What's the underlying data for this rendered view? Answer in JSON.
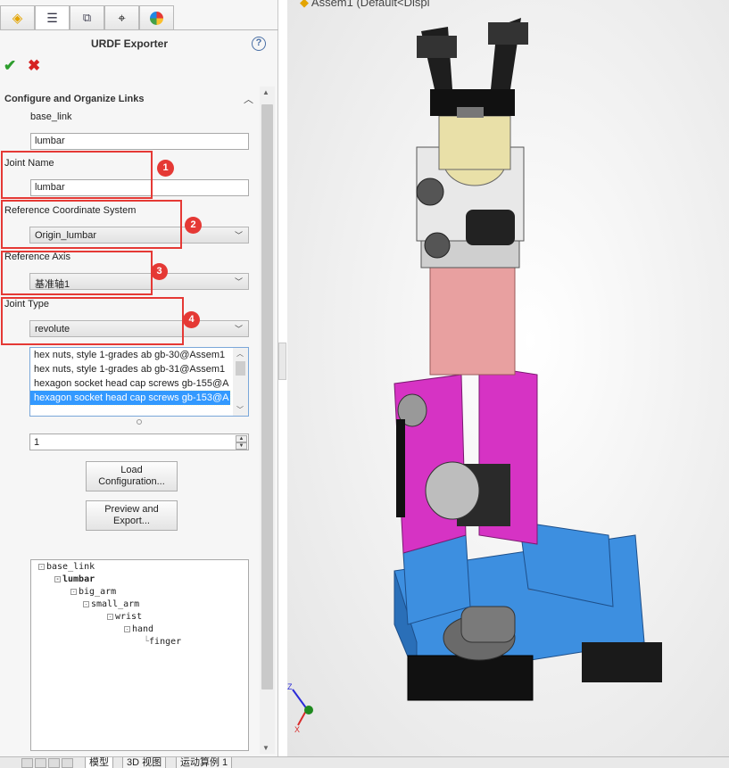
{
  "panel": {
    "title": "URDF Exporter",
    "section_title": "Configure and Organize Links",
    "link_name_label": "base_link",
    "link_name_value": "lumbar",
    "joint_name_label": "Joint Name",
    "joint_name_value": "lumbar",
    "ref_coord_label": "Reference Coordinate System",
    "ref_coord_value": "Origin_lumbar",
    "ref_axis_label": "Reference Axis",
    "ref_axis_value": "基准轴1",
    "joint_type_label": "Joint Type",
    "joint_type_value": "revolute",
    "components": [
      "hex nuts, style 1-grades ab gb-30@Assem1",
      "hex nuts, style 1-grades ab gb-31@Assem1",
      "hexagon socket head cap screws gb-155@A",
      "hexagon socket head cap screws gb-153@A"
    ],
    "children_count": "1",
    "load_config_button": [
      "Load",
      "Configuration..."
    ],
    "preview_export_button": [
      "Preview and",
      "Export..."
    ],
    "badges": [
      "1",
      "2",
      "3",
      "4"
    ]
  },
  "tree": [
    {
      "label": "base_link",
      "bold": false,
      "toggle": "-"
    },
    {
      "label": "lumbar",
      "bold": true,
      "toggle": "-"
    },
    {
      "label": "big_arm",
      "bold": false,
      "toggle": "-"
    },
    {
      "label": "small_arm",
      "bold": false,
      "toggle": "-"
    },
    {
      "label": "wrist",
      "bold": false,
      "toggle": "-"
    },
    {
      "label": "hand",
      "bold": false,
      "toggle": "-"
    },
    {
      "label": "finger",
      "bold": false,
      "toggle": ""
    }
  ],
  "viewport": {
    "title": "Assem1  (Default<Displ"
  },
  "bottom_tabs": [
    "模型",
    "3D 视图",
    "运动算例 1"
  ],
  "colors": {
    "red_annotation": "#e53935",
    "selection": "#3399ff",
    "pink_arm": "#d633c4",
    "blue_base": "#3d8fe0"
  }
}
